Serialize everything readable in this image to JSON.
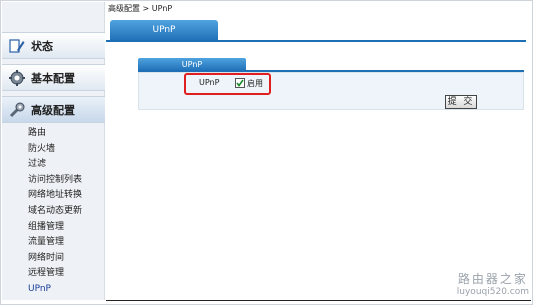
{
  "breadcrumb": "高级配置 > UPnP",
  "tab": "UPnP",
  "sidebar": {
    "sections": [
      {
        "label": "状态"
      },
      {
        "label": "基本配置"
      },
      {
        "label": "高级配置"
      }
    ],
    "items": [
      {
        "label": "路由"
      },
      {
        "label": "防火墙"
      },
      {
        "label": "过滤"
      },
      {
        "label": "访问控制列表"
      },
      {
        "label": "网络地址转换"
      },
      {
        "label": "域名动态更新"
      },
      {
        "label": "组播管理"
      },
      {
        "label": "流量管理"
      },
      {
        "label": "网络时间"
      },
      {
        "label": "远程管理"
      },
      {
        "label": "UPnP"
      }
    ]
  },
  "panel": {
    "title": "UPnP",
    "row_label": "UPnP",
    "checkbox_label": "启用",
    "checkbox_checked": true,
    "highlight_color": "#e02020"
  },
  "submit_label": "提 交",
  "watermark": {
    "title": "路由器之家",
    "url": "luyouqi520.com"
  }
}
